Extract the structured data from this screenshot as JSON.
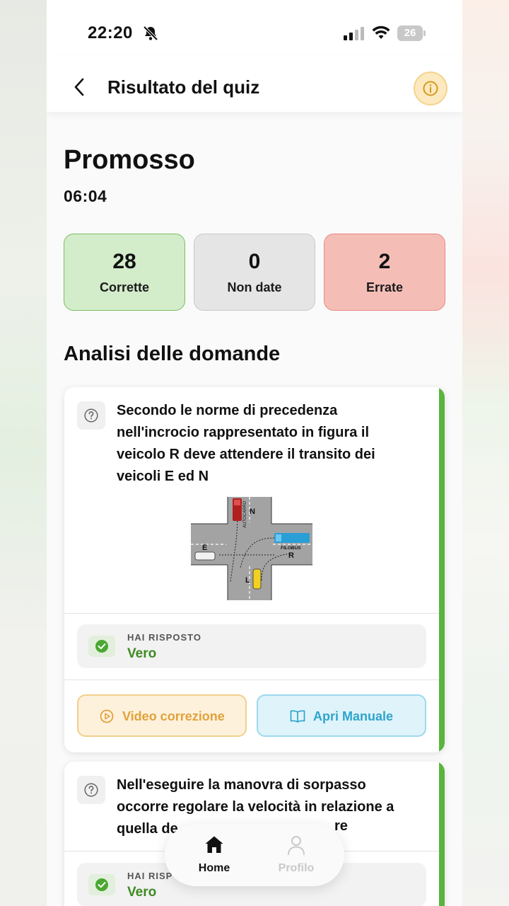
{
  "status_bar": {
    "time": "22:20",
    "battery": "26"
  },
  "header": {
    "title": "Risultato del quiz"
  },
  "result": {
    "status": "Promosso",
    "time": "06:04"
  },
  "stats": [
    {
      "value": "28",
      "label": "Corrette"
    },
    {
      "value": "0",
      "label": "Non date"
    },
    {
      "value": "2",
      "label": "Errate"
    }
  ],
  "section_title": "Analisi delle domande",
  "questions": [
    {
      "text": "Secondo le norme di precedenza nell'incrocio rappresentato in figura il veicolo R deve attendere il transito dei veicoli E ed N",
      "figure_labels": {
        "n": "N",
        "truck": "AUTOCARRO",
        "bus": "FILOBUS",
        "e": "E",
        "r": "R",
        "l": "L"
      },
      "answer_label": "HAI RISPOSTO",
      "answer_value": "Vero",
      "video_button": "Video correzione",
      "manual_button": "Apri Manuale"
    },
    {
      "text": "Nell'eseguire la manovra di sorpasso occorre regolare la velocità in relazione a quella de",
      "text_tail": "re",
      "answer_label": "HAI RISP",
      "answer_value": "Vero"
    }
  ],
  "bottom_nav": {
    "home": "Home",
    "profile": "Profilo"
  },
  "colors": {
    "correct": "#5ab53c",
    "accent_orange": "#e2a13a",
    "accent_blue": "#2ea4cc"
  }
}
